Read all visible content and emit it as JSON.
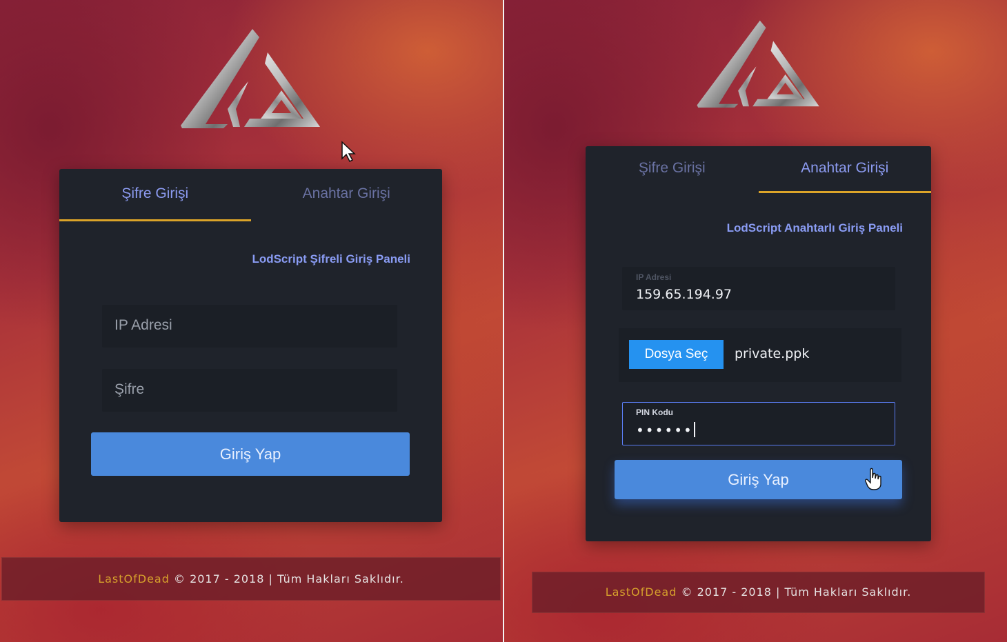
{
  "brand_colors": {
    "tab_active": "#8c9bf1",
    "tab_inactive": "#6a72a3",
    "tab_underline": "#dba429",
    "login_button": "#4a89dc",
    "file_button": "#2592f0",
    "footer_brand": "#d6a02c",
    "card": "#1f232b"
  },
  "left_panel": {
    "logo_icon": "lod-triangle-logo",
    "tabs": [
      {
        "label": "Şifre Girişi",
        "active": true
      },
      {
        "label": "Anahtar Girişi",
        "active": false
      }
    ],
    "panel_title": "LodScript Şifreli Giriş Paneli",
    "ip_field": {
      "placeholder": "IP Adresi",
      "value": ""
    },
    "password_field": {
      "placeholder": "Şifre",
      "value": ""
    },
    "login_button": "Giriş Yap",
    "footer": {
      "brand": "LastOfDead",
      "text": " © 2017 - 2018 | Tüm Hakları Saklıdır."
    }
  },
  "right_panel": {
    "logo_icon": "lod-triangle-logo",
    "tabs": [
      {
        "label": "Şifre Girişi",
        "active": false
      },
      {
        "label": "Anahtar Girişi",
        "active": true
      }
    ],
    "panel_title": "LodScript Anahtarlı Giriş Paneli",
    "ip_field": {
      "label": "IP Adresi",
      "value": "159.65.194.97"
    },
    "file_button": "Dosya Seç",
    "file_name": "private.ppk",
    "pin_field": {
      "label": "PIN Kodu",
      "value": "••••••"
    },
    "login_button": "Giriş Yap",
    "footer": {
      "brand": "LastOfDead",
      "text": " © 2017 - 2018 | Tüm Hakları Saklıdır."
    }
  }
}
